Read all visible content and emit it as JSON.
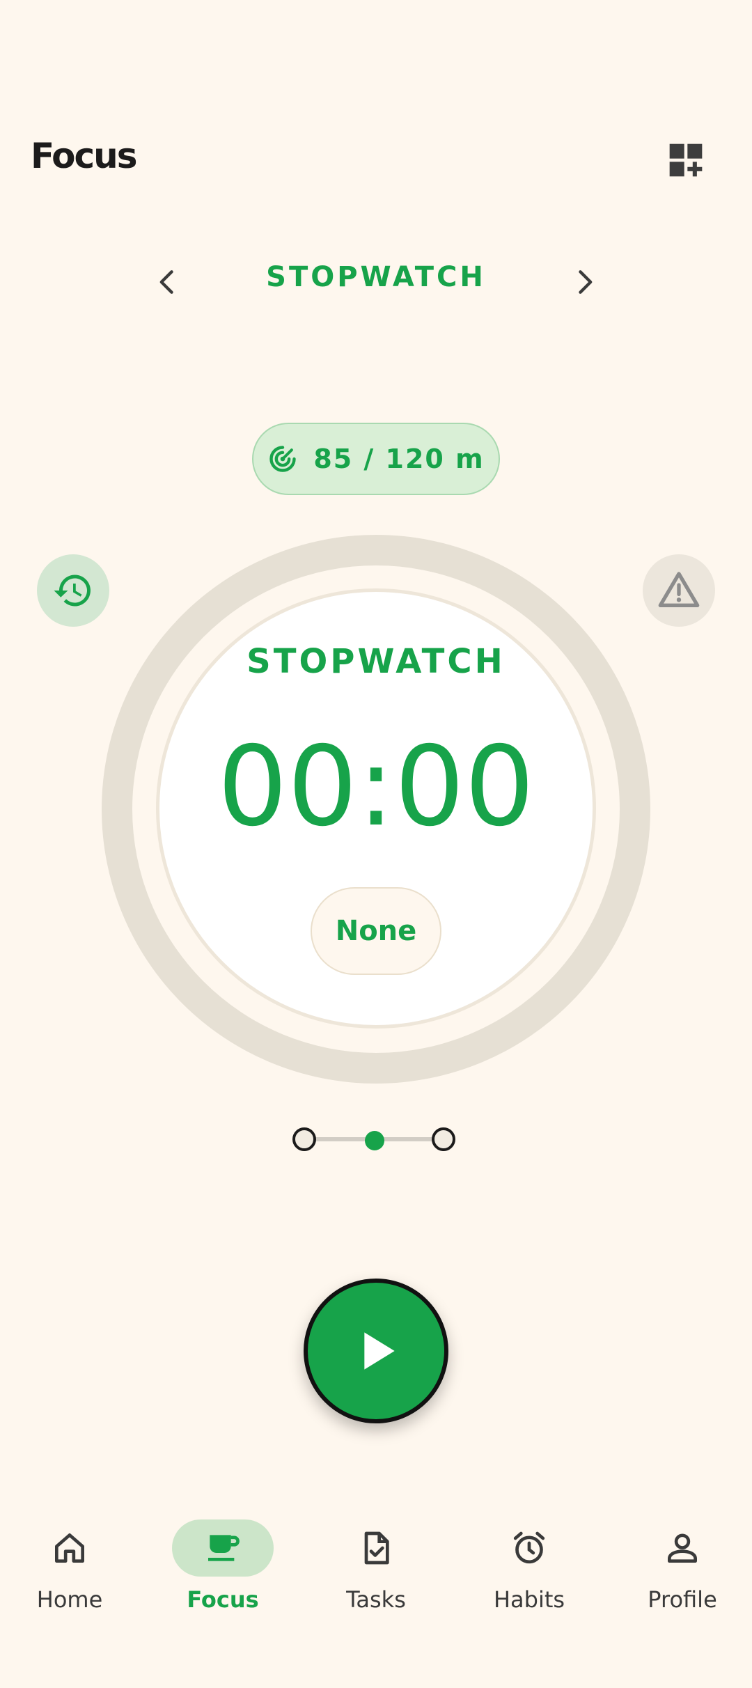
{
  "header": {
    "title": "Focus"
  },
  "mode_switcher": {
    "label": "STOPWATCH"
  },
  "goal": {
    "text": "85 / 120 m"
  },
  "timer": {
    "mode": "STOPWATCH",
    "time": "00:00",
    "tag": "None"
  },
  "stepper": {
    "count": 3,
    "active_index": 1
  },
  "nav": {
    "items": [
      {
        "label": "Home",
        "icon": "home-icon"
      },
      {
        "label": "Focus",
        "icon": "coffee-cup-icon",
        "active": true
      },
      {
        "label": "Tasks",
        "icon": "task-check-icon"
      },
      {
        "label": "Habits",
        "icon": "alarm-clock-icon"
      },
      {
        "label": "Profile",
        "icon": "person-icon"
      }
    ]
  },
  "colors": {
    "background": "#FEF7EE",
    "accent": "#17A34A",
    "accent_container": "#CCE5C9",
    "ring": "#E6E0D4"
  }
}
